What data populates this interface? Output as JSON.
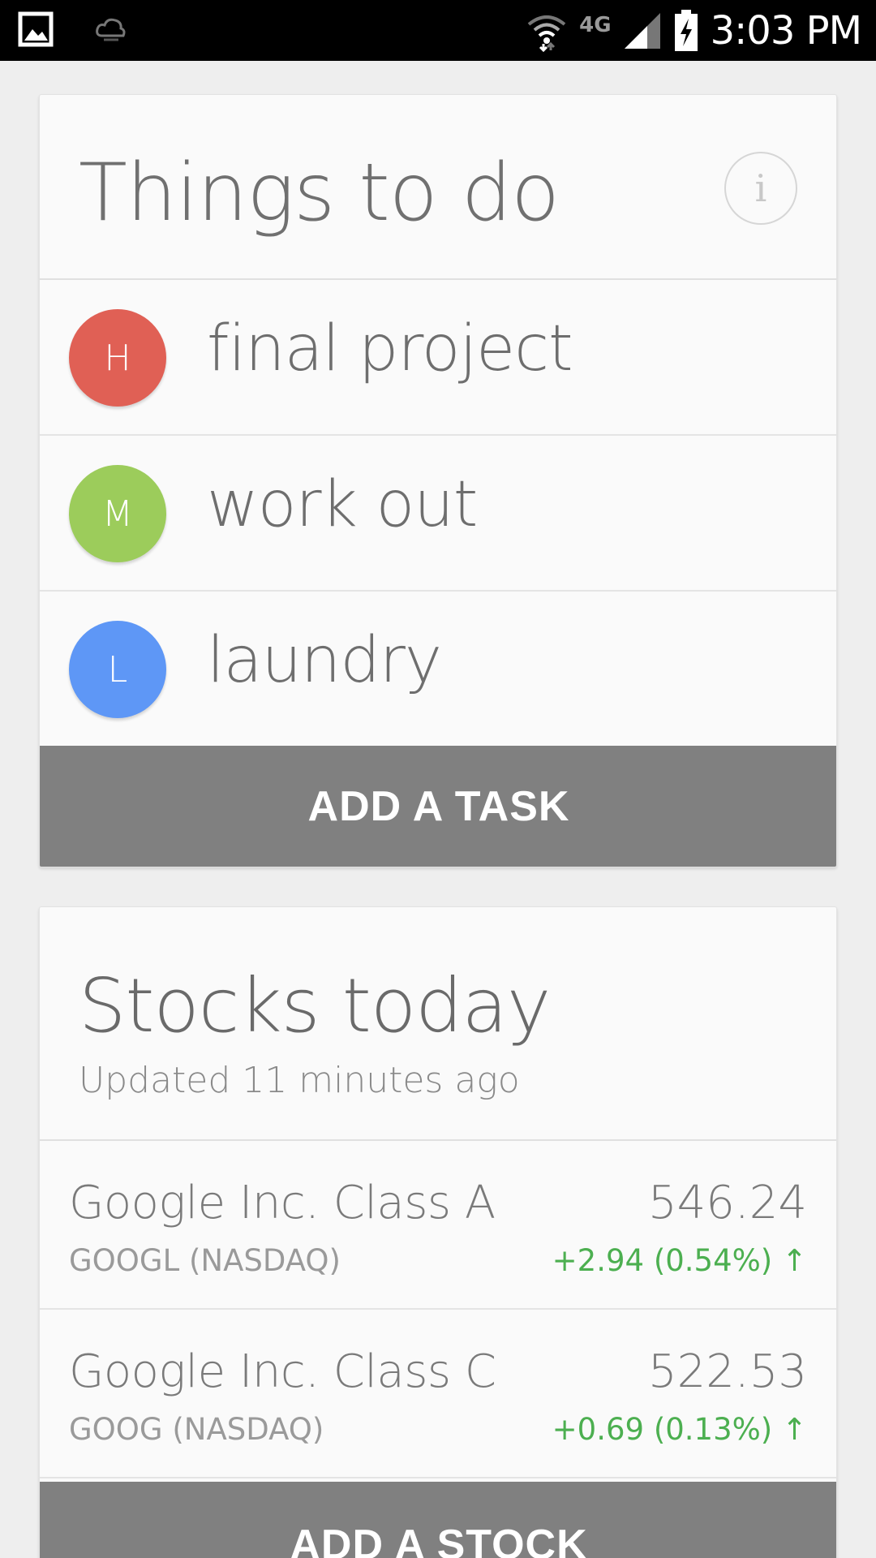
{
  "status_bar": {
    "time": "3:03 PM",
    "icons": [
      "gallery-icon",
      "cloud-upload-icon",
      "wifi-icon",
      "4g-lte-icon",
      "signal-icon",
      "battery-charging-icon"
    ],
    "network_label": "4G"
  },
  "todo_card": {
    "title": "Things to do",
    "info_icon": "i",
    "tasks": [
      {
        "priority": "H",
        "label": "final project",
        "color": "#e06055"
      },
      {
        "priority": "M",
        "label": "work out",
        "color": "#9ccc5b"
      },
      {
        "priority": "L",
        "label": "laundry",
        "color": "#5e97f6"
      }
    ],
    "add_button_label": "ADD A TASK"
  },
  "stocks_card": {
    "title": "Stocks today",
    "subtitle": "Updated 11 minutes ago",
    "stocks": [
      {
        "name": "Google Inc. Class A",
        "ticker": "GOOGL (NASDAQ)",
        "price": "546.24",
        "change": "+2.94 (0.54%) ↑",
        "change_color": "#4caf50"
      },
      {
        "name": "Google Inc. Class C",
        "ticker": "GOOG (NASDAQ)",
        "price": "522.53",
        "change": "+0.69 (0.13%) ↑",
        "change_color": "#4caf50"
      }
    ],
    "add_button_label": "ADD A STOCK"
  },
  "colors": {
    "background": "#eeeeee",
    "card": "#fafafa",
    "button": "#808080",
    "status_bar": "#000000",
    "positive": "#4caf50"
  }
}
